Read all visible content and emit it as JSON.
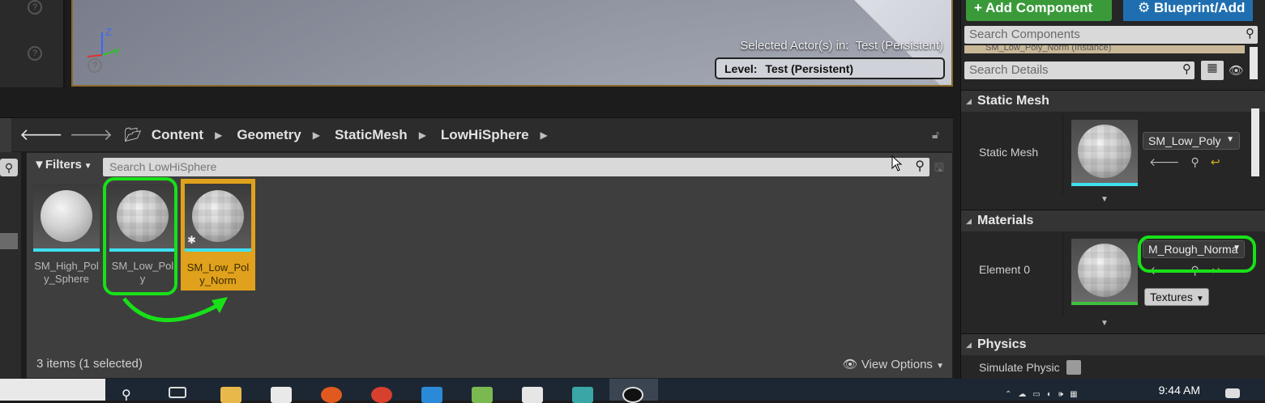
{
  "viewport": {
    "axis_z": "Z",
    "axis_y": "Y",
    "selected_label": "Selected Actor(s) in:",
    "selected_value": "Test (Persistent)",
    "level_label": "Level:",
    "level_value": "Test (Persistent)"
  },
  "content_browser": {
    "breadcrumbs": [
      "Content",
      "Geometry",
      "StaticMesh",
      "LowHiSphere"
    ],
    "filters_label": "Filters",
    "search_placeholder": "Search LowHiSphere",
    "assets": [
      {
        "name": "SM_High_Poly_Sphere",
        "selected": false,
        "highlighted": false
      },
      {
        "name": "SM_Low_Poly",
        "selected": false,
        "highlighted": true
      },
      {
        "name": "SM_Low_Poly_Norm",
        "selected": true,
        "highlighted": false
      }
    ],
    "item_count": "3 items (1 selected)",
    "view_options_label": "View Options"
  },
  "details": {
    "add_component_label": "+ Add Component",
    "blueprint_label": "Blueprint/Add",
    "search_components_placeholder": "Search Components",
    "component_row": "SM_Low_Poly_Norm (Instance)",
    "search_details_placeholder": "Search Details",
    "static_mesh_section": "Static Mesh",
    "static_mesh_label": "Static Mesh",
    "static_mesh_value": "SM_Low_Poly",
    "materials_section": "Materials",
    "element_label": "Element 0",
    "material_value": "M_Rough_Norma",
    "textures_label": "Textures",
    "physics_section": "Physics",
    "simulate_label": "Simulate Physic"
  },
  "taskbar": {
    "clock": "9:44 AM"
  },
  "colors": {
    "annotation": "#18e018",
    "selected_asset": "#e0a11c",
    "thumb_strip": "#3ee0f0",
    "add_component": "#3a9a3a",
    "blueprint": "#1f6fb0"
  }
}
